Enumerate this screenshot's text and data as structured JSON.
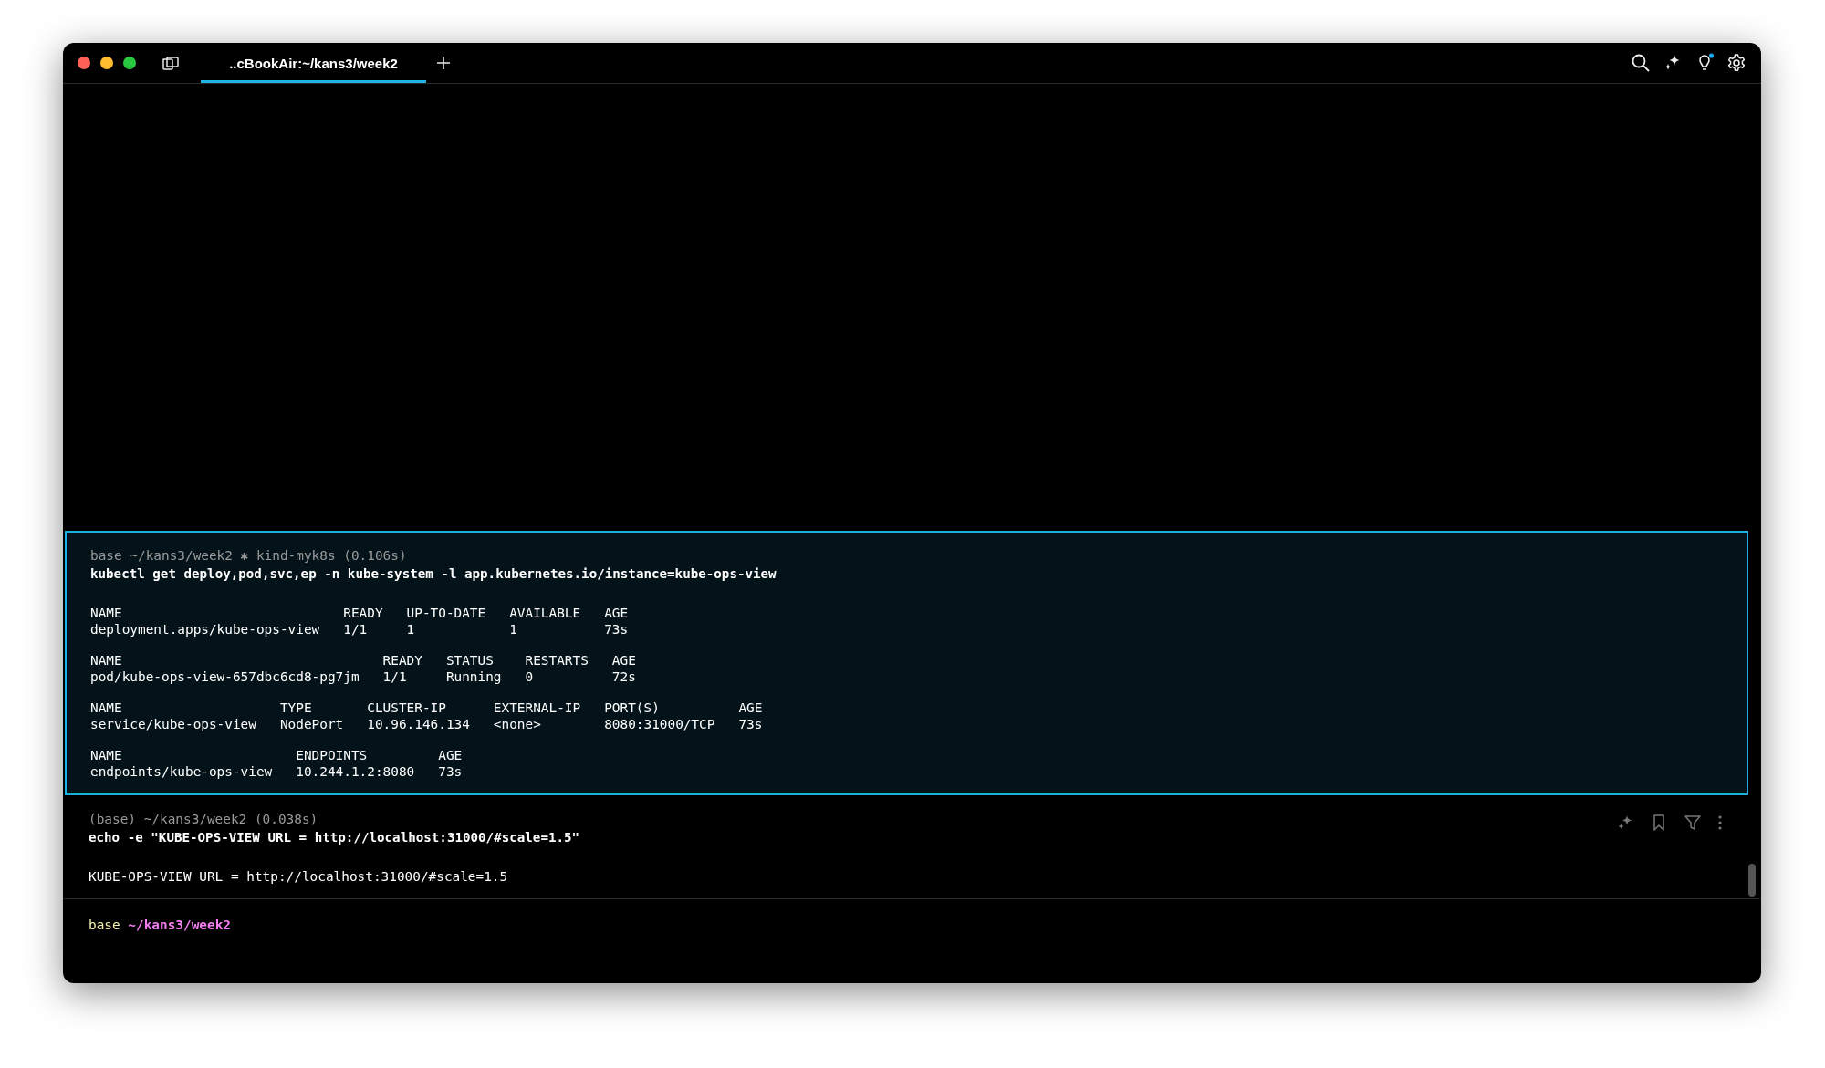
{
  "window": {
    "tabs": [
      {
        "title": "..cBookAir:~/kans3/week2",
        "selected": true
      }
    ]
  },
  "blocks": [
    {
      "selected": true,
      "hovered": false,
      "prompt": "base ~/kans3/week2 ✱ kind-myk8s (0.106s)",
      "command": "kubectl get deploy,pod,svc,ep -n kube-system -l app.kubernetes.io/instance=kube-ops-view",
      "tables": [
        {
          "header": "NAME                            READY   UP-TO-DATE   AVAILABLE   AGE",
          "row": "deployment.apps/kube-ops-view   1/1     1            1           73s"
        },
        {
          "header": "NAME                                 READY   STATUS    RESTARTS   AGE",
          "row": "pod/kube-ops-view-657dbc6cd8-pg7jm   1/1     Running   0          72s"
        },
        {
          "header": "NAME                    TYPE       CLUSTER-IP      EXTERNAL-IP   PORT(S)          AGE",
          "row": "service/kube-ops-view   NodePort   10.96.146.134   <none>        8080:31000/TCP   73s"
        },
        {
          "header": "NAME                      ENDPOINTS         AGE",
          "row": "endpoints/kube-ops-view   10.244.1.2:8080   73s"
        }
      ]
    },
    {
      "selected": false,
      "hovered": true,
      "prompt": "(base) ~/kans3/week2 (0.038s)",
      "command": "echo -e \"KUBE-OPS-VIEW URL = http://localhost:31000/#scale=1.5\"",
      "output": "KUBE-OPS-VIEW URL = http://localhost:31000/#scale=1.5"
    }
  ],
  "input_prompt": {
    "env": "base",
    "path": "~/kans3/week2"
  }
}
